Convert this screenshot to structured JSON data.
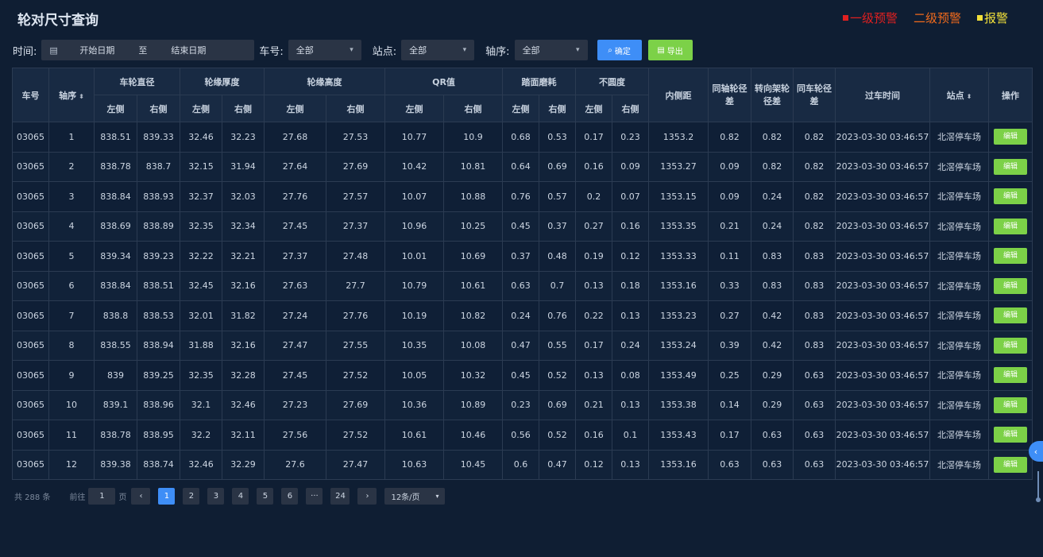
{
  "header": {
    "title": "轮对尺寸查询",
    "legend": [
      {
        "label": "一级预警",
        "color": "#e02020"
      },
      {
        "label": "二级预警",
        "color": "#f06a1c"
      },
      {
        "label": "报警",
        "color": "#f2e03a"
      }
    ]
  },
  "filters": {
    "time_label": "时间:",
    "date_icon": "calendar-icon",
    "start_placeholder": "开始日期",
    "range_sep": "至",
    "end_placeholder": "结束日期",
    "car_label": "车号:",
    "car_value": "全部",
    "station_label": "站点:",
    "station_value": "全部",
    "axle_label": "轴序:",
    "axle_value": "全部",
    "confirm_label": "确定",
    "export_label": "导出"
  },
  "table": {
    "headers": {
      "car_no": "车号",
      "axle_no": "轴序",
      "wheel_dia": "车轮直径",
      "flange_thk": "轮缘厚度",
      "flange_hgt": "轮缘高度",
      "qr": "QR值",
      "tread_wear": "踏面磨耗",
      "out_of_round": "不圆度",
      "inner_dist": "内侧距",
      "same_axle_diff": "同轴轮径差",
      "bogie_diff": "转向架轮径差",
      "same_car_diff": "同车轮径差",
      "pass_time": "过车时间",
      "station": "站点",
      "action": "操作",
      "left": "左侧",
      "right": "右侧"
    },
    "edit_label": "编辑",
    "rows": [
      [
        "03065",
        "1",
        "838.51",
        "839.33",
        "32.46",
        "32.23",
        "27.68",
        "27.53",
        "10.77",
        "10.9",
        "0.68",
        "0.53",
        "0.17",
        "0.23",
        "1353.2",
        "0.82",
        "0.82",
        "0.82",
        "2023-03-30 03:46:57",
        "北滘停车场"
      ],
      [
        "03065",
        "2",
        "838.78",
        "838.7",
        "32.15",
        "31.94",
        "27.64",
        "27.69",
        "10.42",
        "10.81",
        "0.64",
        "0.69",
        "0.16",
        "0.09",
        "1353.27",
        "0.09",
        "0.82",
        "0.82",
        "2023-03-30 03:46:57",
        "北滘停车场"
      ],
      [
        "03065",
        "3",
        "838.84",
        "838.93",
        "32.37",
        "32.03",
        "27.76",
        "27.57",
        "10.07",
        "10.88",
        "0.76",
        "0.57",
        "0.2",
        "0.07",
        "1353.15",
        "0.09",
        "0.24",
        "0.82",
        "2023-03-30 03:46:57",
        "北滘停车场"
      ],
      [
        "03065",
        "4",
        "838.69",
        "838.89",
        "32.35",
        "32.34",
        "27.45",
        "27.37",
        "10.96",
        "10.25",
        "0.45",
        "0.37",
        "0.27",
        "0.16",
        "1353.35",
        "0.21",
        "0.24",
        "0.82",
        "2023-03-30 03:46:57",
        "北滘停车场"
      ],
      [
        "03065",
        "5",
        "839.34",
        "839.23",
        "32.22",
        "32.21",
        "27.37",
        "27.48",
        "10.01",
        "10.69",
        "0.37",
        "0.48",
        "0.19",
        "0.12",
        "1353.33",
        "0.11",
        "0.83",
        "0.83",
        "2023-03-30 03:46:57",
        "北滘停车场"
      ],
      [
        "03065",
        "6",
        "838.84",
        "838.51",
        "32.45",
        "32.16",
        "27.63",
        "27.7",
        "10.79",
        "10.61",
        "0.63",
        "0.7",
        "0.13",
        "0.18",
        "1353.16",
        "0.33",
        "0.83",
        "0.83",
        "2023-03-30 03:46:57",
        "北滘停车场"
      ],
      [
        "03065",
        "7",
        "838.8",
        "838.53",
        "32.01",
        "31.82",
        "27.24",
        "27.76",
        "10.19",
        "10.82",
        "0.24",
        "0.76",
        "0.22",
        "0.13",
        "1353.23",
        "0.27",
        "0.42",
        "0.83",
        "2023-03-30 03:46:57",
        "北滘停车场"
      ],
      [
        "03065",
        "8",
        "838.55",
        "838.94",
        "31.88",
        "32.16",
        "27.47",
        "27.55",
        "10.35",
        "10.08",
        "0.47",
        "0.55",
        "0.17",
        "0.24",
        "1353.24",
        "0.39",
        "0.42",
        "0.83",
        "2023-03-30 03:46:57",
        "北滘停车场"
      ],
      [
        "03065",
        "9",
        "839",
        "839.25",
        "32.35",
        "32.28",
        "27.45",
        "27.52",
        "10.05",
        "10.32",
        "0.45",
        "0.52",
        "0.13",
        "0.08",
        "1353.49",
        "0.25",
        "0.29",
        "0.63",
        "2023-03-30 03:46:57",
        "北滘停车场"
      ],
      [
        "03065",
        "10",
        "839.1",
        "838.96",
        "32.1",
        "32.46",
        "27.23",
        "27.69",
        "10.36",
        "10.89",
        "0.23",
        "0.69",
        "0.21",
        "0.13",
        "1353.38",
        "0.14",
        "0.29",
        "0.63",
        "2023-03-30 03:46:57",
        "北滘停车场"
      ],
      [
        "03065",
        "11",
        "838.78",
        "838.95",
        "32.2",
        "32.11",
        "27.56",
        "27.52",
        "10.61",
        "10.46",
        "0.56",
        "0.52",
        "0.16",
        "0.1",
        "1353.43",
        "0.17",
        "0.63",
        "0.63",
        "2023-03-30 03:46:57",
        "北滘停车场"
      ],
      [
        "03065",
        "12",
        "839.38",
        "838.74",
        "32.46",
        "32.29",
        "27.6",
        "27.47",
        "10.63",
        "10.45",
        "0.6",
        "0.47",
        "0.12",
        "0.13",
        "1353.16",
        "0.63",
        "0.63",
        "0.63",
        "2023-03-30 03:46:57",
        "北滘停车场"
      ]
    ]
  },
  "pagination": {
    "total": "共 288 条",
    "goto_prefix": "前往",
    "goto_value": "1",
    "goto_suffix": "页",
    "prev": "‹",
    "next": "›",
    "pages": [
      "1",
      "2",
      "3",
      "4",
      "5",
      "6",
      "···",
      "24"
    ],
    "current": "1",
    "page_size": "12条/页"
  },
  "side_tab": "‹"
}
